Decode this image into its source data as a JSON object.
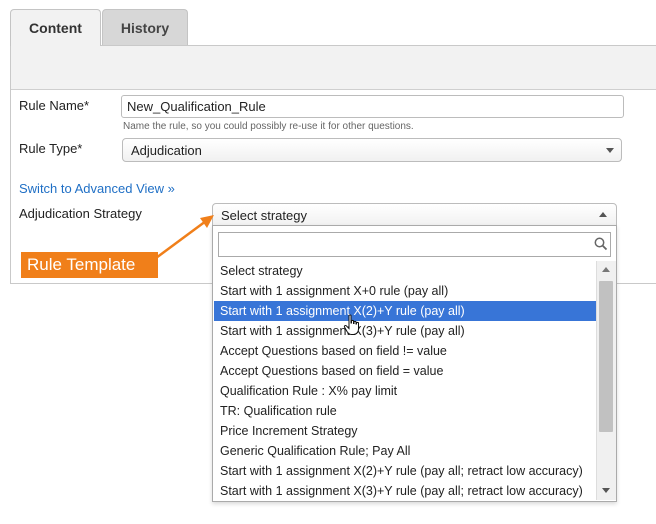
{
  "tabs": [
    {
      "label": "Content",
      "active": true
    },
    {
      "label": "History",
      "active": false
    }
  ],
  "form": {
    "rule_name_label": "Rule Name*",
    "rule_name_value": "New_Qualification_Rule",
    "rule_name_hint": "Name the rule, so you could possibly re-use it for other questions.",
    "rule_type_label": "Rule Type*",
    "rule_type_value": "Adjudication",
    "advanced_link": "Switch to Advanced View »",
    "strategy_label": "Adjudication Strategy",
    "strategy_placeholder": "Select strategy"
  },
  "dropdown": {
    "search_value": "",
    "highlighted_index": 2,
    "options": [
      "Select strategy",
      "Start with 1 assignment X+0 rule (pay all)",
      "Start with 1 assignment X(2)+Y rule (pay all)",
      "Start with 1 assignment X(3)+Y rule (pay all)",
      "Accept Questions based on field != value",
      "Accept Questions based on field = value",
      "Qualification Rule : X% pay limit",
      "TR: Qualification rule",
      "Price Increment Strategy",
      "Generic Qualification Rule; Pay All",
      "Start with 1 assignment X(2)+Y rule (pay all; retract low accuracy)",
      "Start with 1 assignment X(3)+Y rule (pay all; retract low accuracy)"
    ]
  },
  "annotation": {
    "label": "Rule Template",
    "color": "#f07f1a"
  },
  "colors": {
    "accent": "#3875d7",
    "link": "#1f6fc5"
  }
}
